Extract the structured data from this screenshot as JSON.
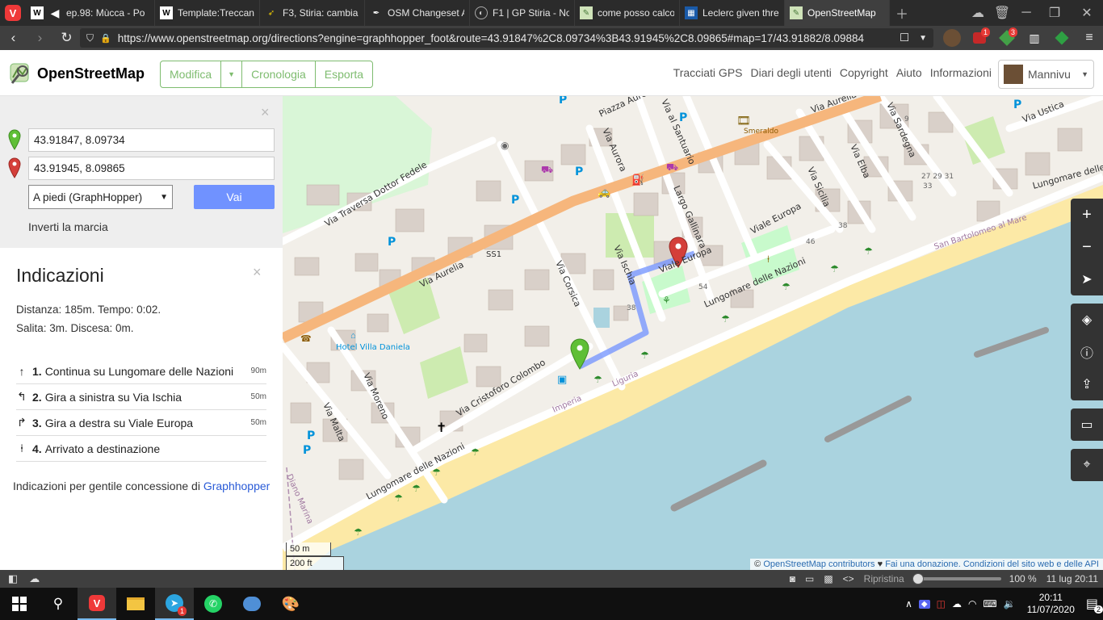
{
  "browser": {
    "tabs": [
      {
        "title": "ep.98: Mùcca - Po",
        "favicon": "wikipedia-icon"
      },
      {
        "title": "",
        "favicon": "speaker-icon"
      },
      {
        "title": "Template:Treccani",
        "favicon": "wikipedia-icon"
      },
      {
        "title": "F3, Stiria: cambia l",
        "favicon": "f1-icon"
      },
      {
        "title": "OSM Changeset A",
        "favicon": "osm-changeset-icon"
      },
      {
        "title": "F1 | GP Stiria - No",
        "favicon": "f1-circle-icon"
      },
      {
        "title": "come posso calco",
        "favicon": "map-icon"
      },
      {
        "title": "Leclerc given thre",
        "favicon": "news-icon"
      },
      {
        "title": "OpenStreetMap",
        "favicon": "osm-icon",
        "active": true
      }
    ],
    "url": "https://www.openstreetmap.org/directions?engine=graphhopper_foot&route=43.91847%2C8.09734%3B43.91945%2C8.09865#map=17/43.91882/8.09884",
    "extension_badges": [
      "1",
      "3"
    ]
  },
  "osm": {
    "brand": "OpenStreetMap",
    "edit_menu": {
      "edit": "Modifica",
      "history": "Cronologia",
      "export": "Esporta"
    },
    "nav_links": [
      "Tracciati GPS",
      "Diari degli utenti",
      "Copyright",
      "Aiuto",
      "Informazioni"
    ],
    "user": "Mannivu"
  },
  "route_form": {
    "from_value": "43.91847, 8.09734",
    "to_value": "43.91945, 8.09865",
    "engine_selected": "A piedi (GraphHopper)",
    "go_label": "Vai",
    "reverse_label": "Inverti la marcia"
  },
  "directions": {
    "title": "Indicazioni",
    "summary_line1": "Distanza: 185m. Tempo: 0:02.",
    "summary_line2": "Salita: 3m. Discesa: 0m.",
    "steps": [
      {
        "icon": "straight-arrow-icon",
        "num": "1.",
        "text": "Continua su Lungomare delle Nazioni",
        "dist": "90m"
      },
      {
        "icon": "turn-left-icon",
        "num": "2.",
        "text": "Gira a sinistra su Via Ischia",
        "dist": "50m"
      },
      {
        "icon": "turn-right-icon",
        "num": "3.",
        "text": "Gira a destra su Viale Europa",
        "dist": "50m"
      },
      {
        "icon": "destination-icon",
        "num": "4.",
        "text": "Arrivato a destinazione",
        "dist": ""
      }
    ],
    "credit_prefix": "Indicazioni per gentile concessione di",
    "credit_link": "Graphhopper"
  },
  "map": {
    "labels": {
      "via_aurelia": "Via Aurelia",
      "via_aurelia_top": "Via Aurelia",
      "ss1": "SS1",
      "via_traversa": "Via Traversa Dottor Fedele",
      "via_corsica": "Via Corsica",
      "via_ischia": "Via Ischia",
      "via_aurora": "Via Aurora",
      "via_al_santuario": "Via al Santuario",
      "piazza_aurelia": "Piazza Aurelia",
      "largo_gallinara": "Largo Gallinara",
      "viale_europa": "Viale Europa",
      "viale_europa_2": "Viale Europa",
      "via_sicilia": "Via Sicilia",
      "via_elba": "Via Elba",
      "via_sardegna": "Via Sardegna",
      "via_ustica": "Via Ustica",
      "lungomare": "Lungomare delle Nazioni",
      "lungomare_2": "Lungomare delle Nazioni",
      "lungomare_3": "Lungomare delle Nazioni",
      "via_cristoforo": "Via Cristoforo Colombo",
      "via_moreno": "Via Moreno",
      "via_malta": "Via Malta",
      "hotel": "Hotel Villa Daniela",
      "smeraldo": "Smeraldo",
      "imperia": "Imperia",
      "liguria": "Liguria",
      "diano_marina": "Diano Marina",
      "san_bartolomeo": "San Bartolomeo al Mare",
      "n9": "9",
      "n27": "27 29 31",
      "n33": "33",
      "n46": "46",
      "n38": "38",
      "n38b": "38",
      "n54": "54"
    },
    "scale_metric": "50 m",
    "scale_imperial": "200 ft",
    "attribution_prefix": "©",
    "attribution_contrib": "OpenStreetMap contributors",
    "attribution_heart": "♥",
    "attribution_donate": "Fai una donazione.",
    "attribution_terms": "Condizioni del sito web e delle API"
  },
  "statusbar": {
    "zoom_label": "Ripristina",
    "zoom": "100 %",
    "date_time": "11 lug  20:11"
  },
  "taskbar": {
    "time": "20:11",
    "date": "11/07/2020",
    "notif_count": "2",
    "telegram_badge": "1"
  },
  "colors": {
    "osm_green": "#7ebc6f",
    "route_blue": "#7092ff",
    "aurelia_orange": "#f6b67c",
    "sea": "#aad3df",
    "beach": "#fce9a6",
    "park": "#c8facc"
  }
}
